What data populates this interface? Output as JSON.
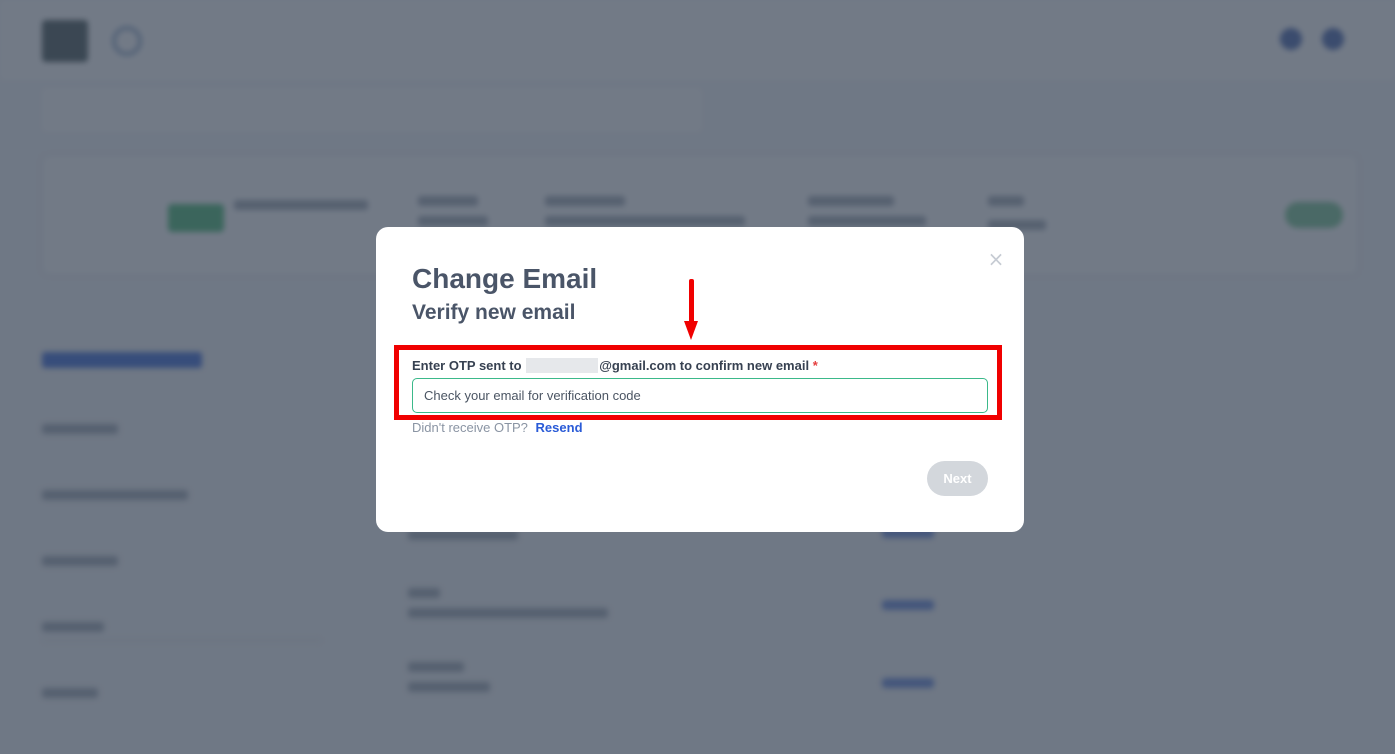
{
  "modal": {
    "close_icon": "×",
    "title": "Change Email",
    "subtitle": "Verify new email",
    "otp_label_prefix": "Enter OTP sent to",
    "otp_label_suffix": "@gmail.com to confirm new email",
    "required_mark": "*",
    "otp_placeholder": "Check your email for verification code",
    "otp_value": "",
    "resend_prompt": "Didn't receive OTP?",
    "resend_link": "Resend",
    "next_button": "Next"
  },
  "icons": {
    "close": "close-icon",
    "arrow": "arrow-down-icon"
  },
  "colors": {
    "annotation": "#f00000",
    "input_border": "#3bb98a",
    "link": "#2a5bd7",
    "required": "#e53e3e",
    "disabled_button": "#d3d7dc"
  }
}
